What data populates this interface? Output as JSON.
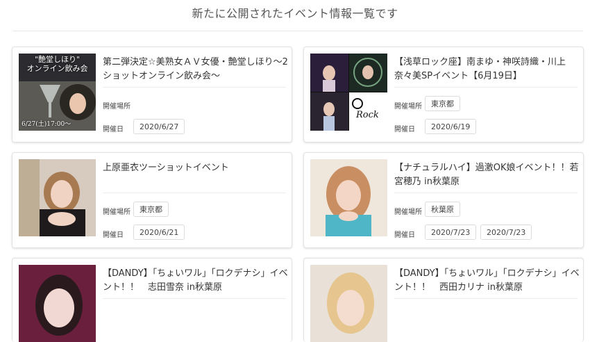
{
  "page": {
    "title": "新たに公開されたイベント情報一覧です"
  },
  "labels": {
    "venue": "開催場所",
    "date": "開催日"
  },
  "events": [
    {
      "title": "第二弾決定☆美熟女ＡＶ女優・艶堂しほり〜2ショットオンライン飲み会〜",
      "venue": "",
      "dates": [
        "2020/6/27"
      ],
      "thumb_top_text": "\"艶堂しほり\"\nオンライン飲み会",
      "thumb_caption": "6/27(土)17:00〜"
    },
    {
      "title": "【浅草ロック座】南まゆ・神咲詩織・川上奈々美SPイベント【6月19日】",
      "venue": "東京都",
      "dates": [
        "2020/6/19"
      ]
    },
    {
      "title": "上原亜衣ツーショットイベント",
      "venue": "東京都",
      "dates": [
        "2020/6/21"
      ]
    },
    {
      "title": "【ナチュラルハイ】過激OK娘イベント！！若宮穂乃 in秋葉原",
      "venue": "秋葉原",
      "dates": [
        "2020/7/23",
        "2020/7/23"
      ]
    },
    {
      "title": "【DANDY】「ちょいワル」「ロクデナシ」イベント！！　志田雪奈 in秋葉原",
      "venue": "",
      "dates": []
    },
    {
      "title": "【DANDY】「ちょいワル」「ロクデナシ」イベント！！　西田カリナ in秋葉原",
      "venue": "",
      "dates": []
    }
  ]
}
